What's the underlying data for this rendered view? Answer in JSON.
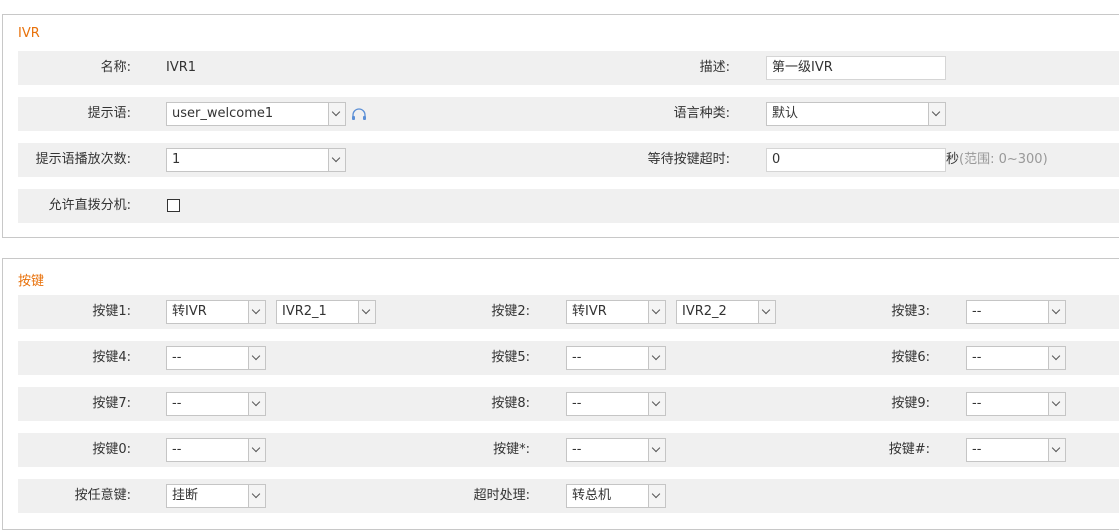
{
  "ivr": {
    "title": "IVR",
    "name_label": "名称:",
    "name_value": "IVR1",
    "desc_label": "描述:",
    "desc_value": "第一级IVR",
    "prompt_label": "提示语:",
    "prompt_value": "user_welcome1",
    "lang_label": "语言种类:",
    "lang_value": "默认",
    "repeat_label": "提示语播放次数:",
    "repeat_value": "1",
    "timeout_label": "等待按键超时:",
    "timeout_value": "0",
    "timeout_unit": "秒",
    "timeout_range": "(范围: 0~300)",
    "direct_label": "允许直拨分机:",
    "direct_checked": false
  },
  "keys": {
    "title": "按键",
    "k1_label": "按键1:",
    "k1_action": "转IVR",
    "k1_target": "IVR2_1",
    "k2_label": "按键2:",
    "k2_action": "转IVR",
    "k2_target": "IVR2_2",
    "k3_label": "按键3:",
    "k3_action": "--",
    "k4_label": "按键4:",
    "k4_action": "--",
    "k5_label": "按键5:",
    "k5_action": "--",
    "k6_label": "按键6:",
    "k6_action": "--",
    "k7_label": "按键7:",
    "k7_action": "--",
    "k8_label": "按键8:",
    "k8_action": "--",
    "k9_label": "按键9:",
    "k9_action": "--",
    "k0_label": "按键0:",
    "k0_action": "--",
    "kstar_label": "按键*:",
    "kstar_action": "--",
    "khash_label": "按键#:",
    "khash_action": "--",
    "any_label": "按任意键:",
    "any_action": "挂断",
    "timeout_label": "超时处理:",
    "timeout_action": "转总机"
  },
  "colors": {
    "title": "#e8720c",
    "row_bg": "#f0f0f0",
    "icon": "#5b8fd6"
  }
}
